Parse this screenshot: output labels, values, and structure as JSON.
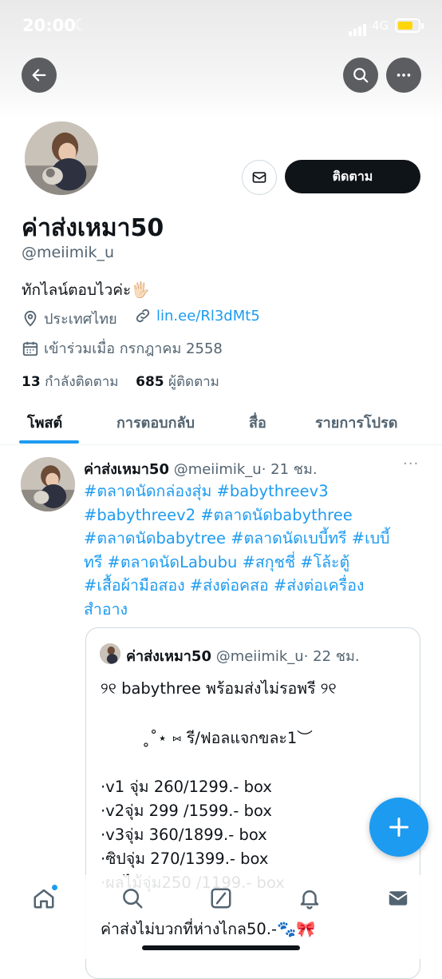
{
  "status_bar": {
    "time": "20:00",
    "network": "4G"
  },
  "profile": {
    "display_name": "ค่าส่งเหมา50",
    "handle": "@meiimik_u",
    "bio": "ทักไลน์ตอบไวค่ะ🖐🏻",
    "location": "ประเทศไทย",
    "link": "lin.ee/Rl3dMt5",
    "joined": "เข้าร่วมเมื่อ กรกฎาคม 2558",
    "following_count": "13",
    "following_label": "กำลังติดตาม",
    "followers_count": "685",
    "followers_label": "ผู้ติดตาม",
    "follow_button": "ติดตาม"
  },
  "tabs": [
    {
      "label": "โพสต์",
      "active": true
    },
    {
      "label": "การตอบกลับ",
      "active": false
    },
    {
      "label": "สื่อ",
      "active": false
    },
    {
      "label": "รายการโปรด",
      "active": false
    }
  ],
  "post": {
    "author": "ค่าส่งเหมา50",
    "handle": "@meiimik_u",
    "time": "· 21 ชม.",
    "more": "···",
    "text_lines": [
      "#ตลาดนัดกล่องสุ่ม #babythreev3",
      "#babythreev2 #ตลาดนัดbabythree",
      "#ตลาดนัดbabytree #ตลาดนัดเบบี้ทรี #เบบี้",
      "ทรี #ตลาดนัดLabubu #สกุชชี่ #โล้ะตู้",
      "#เสื้อผ้ามือสอง #ส่งต่อคสอ #ส่งต่อเครื่อง",
      "สำอาง"
    ],
    "quote": {
      "author": "ค่าส่งเหมา50",
      "handle": "@meiimik_u",
      "time": "· 22 ชม.",
      "lines": [
        "୨୧ babythree พร้อมส่งไม่รอพรี ୨୧",
        "˳˚⋆ ⑅ รี/ฟอลแจกขละ1︶",
        "·v1 จุ่ม 260/1299.- box",
        "·v2จุ่ม 299 /1599.- box",
        "·v3จุ่ม  360/1899.- box",
        "·ซิปจุ่ม 270/1399.- box",
        "·ผลไม้จุ่ม250 /1199.- box",
        "ค่าส่งไม่บวกที่ห่างไกล50.-🐾🎀"
      ]
    }
  },
  "colors": {
    "accent": "#1d9bf0",
    "text": "#0f1419",
    "muted": "#536471"
  },
  "icons": [
    "back-arrow-icon",
    "search-icon",
    "more-icon",
    "mail-icon",
    "location-pin-icon",
    "link-icon",
    "calendar-icon",
    "plus-icon",
    "home-icon",
    "explore-search-icon",
    "grok-icon",
    "bell-icon",
    "messages-icon"
  ]
}
